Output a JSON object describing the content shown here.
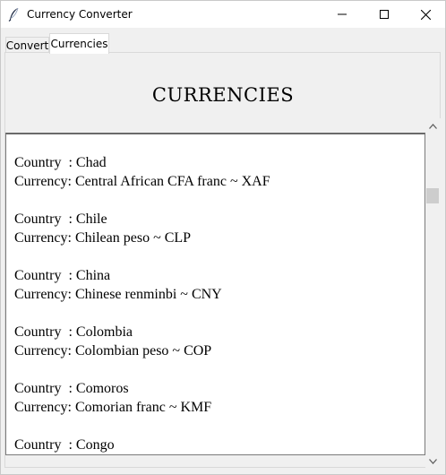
{
  "window": {
    "title": "Currency Converter"
  },
  "tabs": [
    {
      "label": "Convert"
    },
    {
      "label": "Currencies"
    }
  ],
  "page": {
    "heading": "CURRENCIES"
  },
  "currency_list": [
    {
      "country_line": "Country  : Chad",
      "currency_line": "Currency: Central African CFA franc ~ XAF"
    },
    {
      "country_line": "Country  : Chile",
      "currency_line": "Currency: Chilean peso ~ CLP"
    },
    {
      "country_line": "Country  : China",
      "currency_line": "Currency: Chinese renminbi ~ CNY"
    },
    {
      "country_line": "Country  : Colombia",
      "currency_line": "Currency: Colombian peso ~ COP"
    },
    {
      "country_line": "Country  : Comoros",
      "currency_line": "Currency: Comorian franc ~ KMF"
    },
    {
      "country_line": "Country  : Congo",
      "currency_line": ""
    }
  ],
  "icons": {
    "app": "feather-icon",
    "minimize": "minimize-icon",
    "maximize": "maximize-icon",
    "close": "close-icon",
    "scroll_up": "chevron-up-icon",
    "scroll_down": "chevron-down-icon"
  }
}
